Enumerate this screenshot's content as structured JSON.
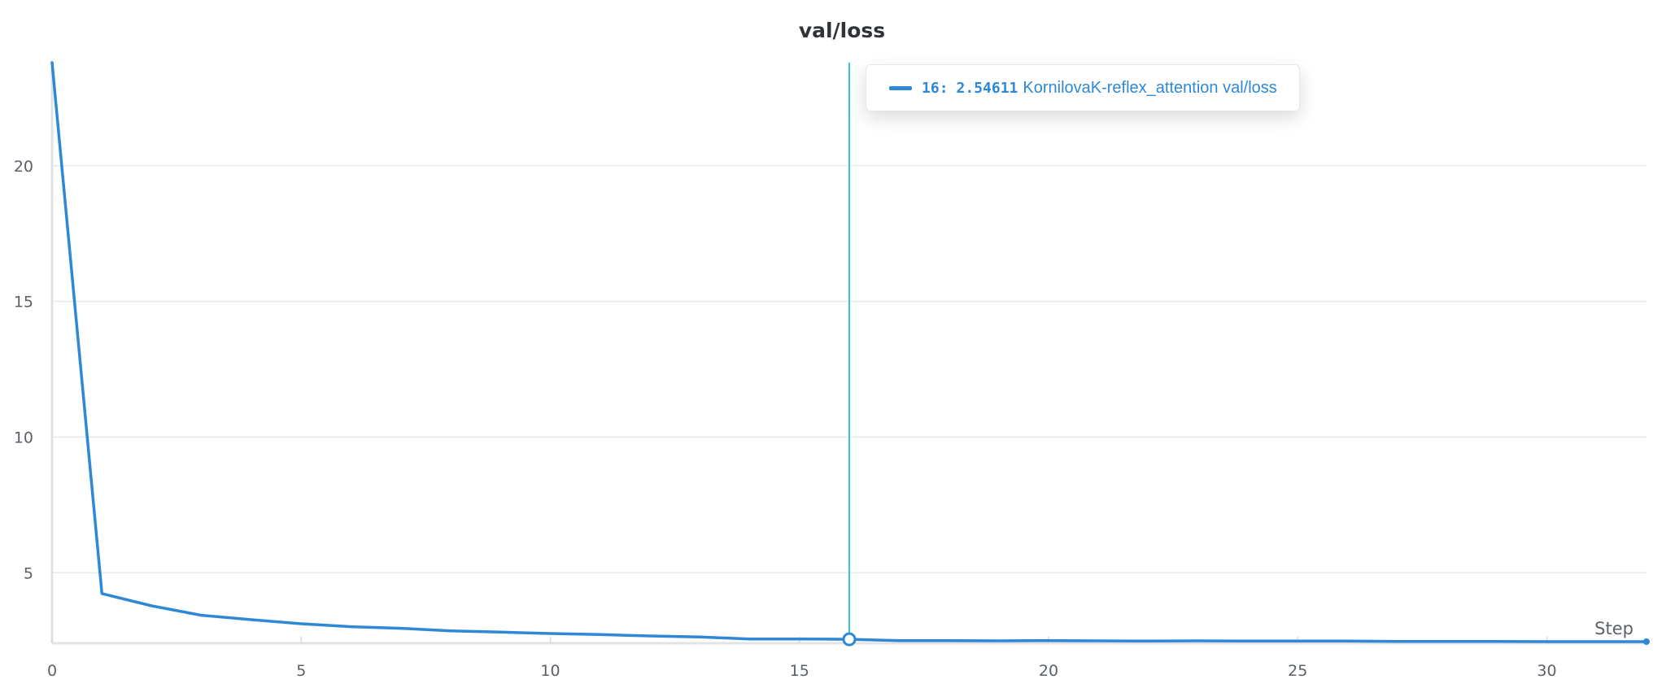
{
  "chart_data": {
    "type": "line",
    "title": "val/loss",
    "xlabel": "Step",
    "ylabel": "",
    "xlim": [
      0,
      32
    ],
    "ylim": [
      2.4,
      23.8
    ],
    "x_ticks": [
      0,
      5,
      10,
      15,
      20,
      25,
      30
    ],
    "y_ticks": [
      5,
      10,
      15,
      20
    ],
    "grid": "horizontal",
    "series": [
      {
        "color": "#2e88d6",
        "x": [
          0,
          1,
          2,
          3,
          4,
          5,
          6,
          7,
          8,
          9,
          10,
          11,
          12,
          13,
          14,
          15,
          16,
          17,
          18,
          19,
          20,
          21,
          22,
          23,
          24,
          25,
          26,
          27,
          28,
          29,
          30,
          31,
          32
        ],
        "values": [
          23.8,
          4.23,
          3.78,
          3.43,
          3.27,
          3.12,
          3.01,
          2.95,
          2.86,
          2.81,
          2.76,
          2.72,
          2.67,
          2.63,
          2.56,
          2.56,
          2.54611,
          2.5,
          2.5,
          2.49,
          2.5,
          2.49,
          2.48,
          2.49,
          2.48,
          2.48,
          2.48,
          2.47,
          2.47,
          2.47,
          2.46,
          2.46,
          2.46
        ]
      }
    ],
    "hover": {
      "x": 16,
      "step_text": "16",
      "separator": ":",
      "value_text": "2.54611",
      "run_label": "KornilovaK-reflex_attention val/loss",
      "crosshair_color": "#35c6d3"
    }
  }
}
